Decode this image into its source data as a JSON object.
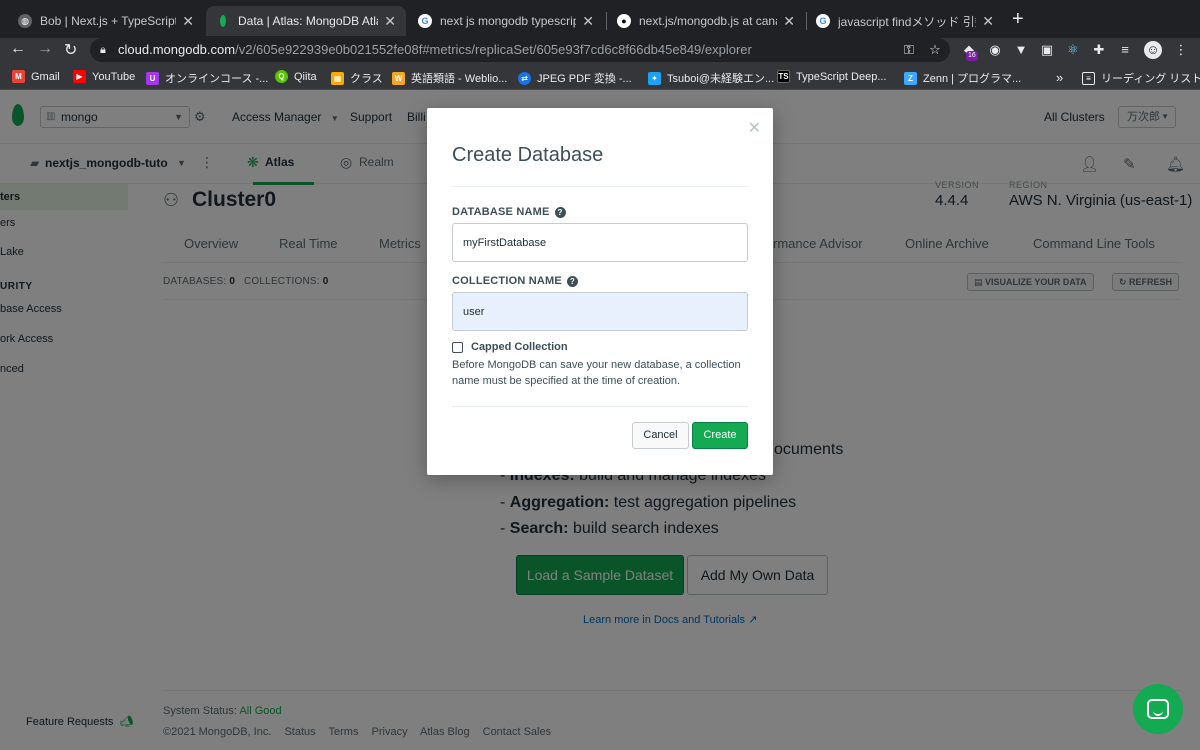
{
  "browser": {
    "tabs": [
      {
        "title": "Bob | Next.js + TypeScript Exa",
        "favicon": "globe-icon"
      },
      {
        "title": "Data | Atlas: MongoDB Atlas",
        "favicon": "mongodb-leaf-icon"
      },
      {
        "title": "next js mongodb typescript - G",
        "favicon": "google-icon"
      },
      {
        "title": "next.js/mongodb.js at canary ·",
        "favicon": "github-icon"
      },
      {
        "title": "javascript findメソッド 引数なし",
        "favicon": "google-icon"
      }
    ],
    "url_host": "cloud.mongodb.com",
    "url_path": "/v2/605e922939e0b021552fe08f#metrics/replicaSet/605e93f7cd6c8f66db45e849/explorer",
    "extension_badge": "16",
    "bookmarks": [
      {
        "label": "Gmail",
        "color": "#ea4335"
      },
      {
        "label": "YouTube",
        "color": "#ff0000"
      },
      {
        "label": "オンラインコース -...",
        "color": "#a435f0"
      },
      {
        "label": "Qiita",
        "color": "#55c500"
      },
      {
        "label": "クラス",
        "color": "#f9ab00"
      },
      {
        "label": "英語類語 - Weblio...",
        "color": "#f5a623"
      },
      {
        "label": "JPEG PDF 変換 -...",
        "color": "#1a73e8"
      },
      {
        "label": "Tsuboi@未経験エン...",
        "color": "#1da1f2"
      },
      {
        "label": "TypeScript Deep...",
        "color": "#000000"
      },
      {
        "label": "Zenn | プログラマ...",
        "color": "#3ea8ff"
      }
    ],
    "bookmarks_more": "»",
    "reading_list": "リーディング リスト"
  },
  "atlas": {
    "org": "mongo",
    "nav": [
      "Access Manager",
      "Support",
      "Billi"
    ],
    "all_clusters": "All Clusters",
    "user": "万次郎",
    "project": "nextjs_mongodb-tuto",
    "subtabs": {
      "atlas": "Atlas",
      "realm": "Realm"
    },
    "sidebar": {
      "items": [
        "ters",
        "ers",
        "Lake"
      ],
      "security_heading": "URITY",
      "security_items": [
        "base Access",
        "ork Access",
        "nced"
      ]
    },
    "cluster": {
      "name": "Cluster0",
      "version_label": "VERSION",
      "version": "4.4.4",
      "region_label": "REGION",
      "region": "AWS N. Virginia (us-east-1)"
    },
    "cluster_tabs": [
      "Overview",
      "Real Time",
      "Metrics",
      "rmance Advisor",
      "Online Archive",
      "Command Line Tools"
    ],
    "counts": {
      "databases_label": "DATABASES:",
      "databases": "0",
      "collections_label": "COLLECTIONS:",
      "collections": "0"
    },
    "visualize_button": "VISUALIZE YOUR DATA",
    "refresh_button": "REFRESH",
    "features": [
      {
        "partial": "ocuments"
      },
      {
        "bold": "Indexes:",
        "text": "build and manage indexes"
      },
      {
        "bold": "Aggregation:",
        "text": "test aggregation pipelines"
      },
      {
        "bold": "Search:",
        "text": "build search indexes"
      }
    ],
    "load_sample": "Load a Sample Dataset",
    "add_own": "Add My Own Data",
    "learn_more": "Learn more in Docs and Tutorials",
    "feature_requests": "Feature Requests",
    "footer": {
      "status_label": "System Status:",
      "status_value": "All Good",
      "copyright": "©2021 MongoDB, Inc.",
      "links": [
        "Status",
        "Terms",
        "Privacy",
        "Atlas Blog",
        "Contact Sales"
      ]
    }
  },
  "modal": {
    "title": "Create Database",
    "db_label": "DATABASE NAME",
    "db_value": "myFirstDatabase",
    "coll_label": "COLLECTION NAME",
    "coll_value": "user",
    "capped_label": "Capped Collection",
    "capped_checked": false,
    "capped_desc": "Before MongoDB can save your new database, a collection name must be specified at the time of creation.",
    "cancel": "Cancel",
    "create": "Create"
  },
  "colors": {
    "accent": "#13aa52",
    "link": "#006cbc",
    "text": "#21313c"
  }
}
